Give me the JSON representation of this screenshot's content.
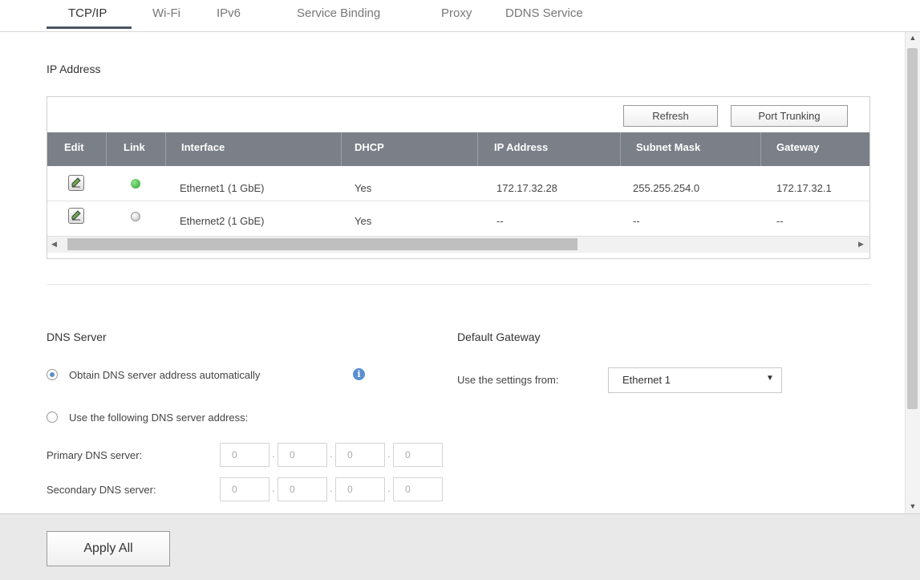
{
  "tabs": [
    {
      "label": "TCP/IP"
    },
    {
      "label": "Wi-Fi"
    },
    {
      "label": "IPv6"
    },
    {
      "label": "Service Binding"
    },
    {
      "label": "Proxy"
    },
    {
      "label": "DDNS Service"
    }
  ],
  "active_tab": "TCP/IP",
  "ip_section": {
    "title": "IP Address",
    "refresh_label": "Refresh",
    "port_trunking_label": "Port Trunking",
    "columns": [
      "Edit",
      "Link",
      "Interface",
      "DHCP",
      "IP Address",
      "Subnet Mask",
      "Gateway"
    ],
    "rows": [
      {
        "link": "up",
        "interface": "Ethernet1 (1 GbE)",
        "dhcp": "Yes",
        "ip": "172.17.32.28",
        "mask": "255.255.254.0",
        "gateway": "172.17.32.1"
      },
      {
        "link": "down",
        "interface": "Ethernet2 (1 GbE)",
        "dhcp": "Yes",
        "ip": "--",
        "mask": "--",
        "gateway": "--"
      }
    ]
  },
  "dns": {
    "title": "DNS Server",
    "auto_label": "Obtain DNS server address automatically",
    "manual_label": "Use the following DNS server address:",
    "selected": "auto",
    "primary_label": "Primary DNS server:",
    "secondary_label": "Secondary DNS server:",
    "primary": [
      "0",
      "0",
      "0",
      "0"
    ],
    "secondary": [
      "0",
      "0",
      "0",
      "0"
    ],
    "info_icon": "info-icon"
  },
  "gateway": {
    "title": "Default Gateway",
    "use_label": "Use the settings from:",
    "selected": "Ethernet 1"
  },
  "footer": {
    "apply_label": "Apply All"
  },
  "colors": {
    "header_bg": "#7a7f88",
    "link_up": "#3cb83c",
    "link_down": "#d6d6d6",
    "radio_accent": "#5b8fc9",
    "info": "#5a8fd0"
  }
}
